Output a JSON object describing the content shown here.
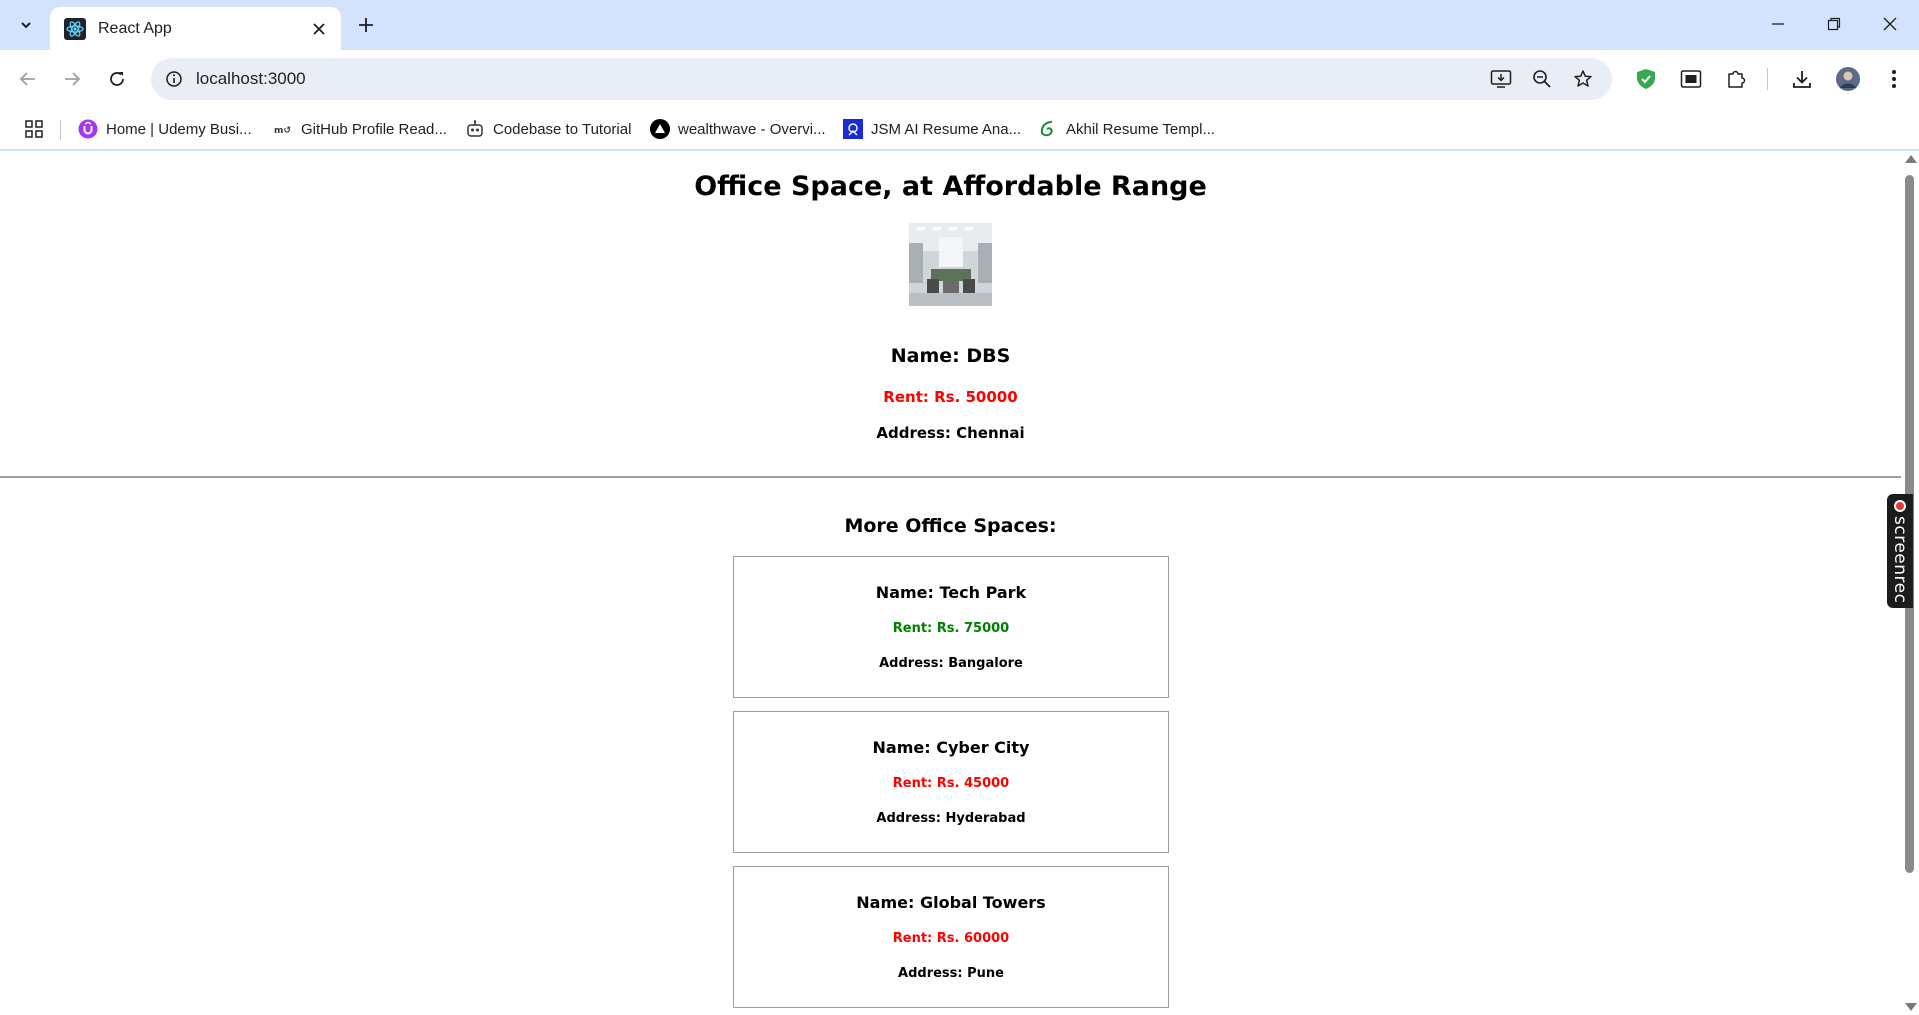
{
  "browser": {
    "tab_title": "React App",
    "url": "localhost:3000",
    "bookmarks": [
      {
        "label": "Home | Udemy Busi...",
        "icon": "udemy-icon"
      },
      {
        "label": "GitHub Profile Read...",
        "icon": "github-readme-icon"
      },
      {
        "label": "Codebase to Tutorial",
        "icon": "robot-icon"
      },
      {
        "label": "wealthwave - Overvi...",
        "icon": "vercel-icon"
      },
      {
        "label": "JSM AI Resume Ana...",
        "icon": "jsm-icon"
      },
      {
        "label": "Akhil Resume Templ...",
        "icon": "overleaf-icon"
      }
    ],
    "colors": {
      "chrome_bg": "#d3e3fd",
      "omnibox_bg": "#e9eef6"
    }
  },
  "page": {
    "title": "Office Space, at Affordable Range",
    "featured": {
      "name": "Name: DBS",
      "rent": "Rent: Rs. 50000",
      "rent_color": "#ff0000",
      "address": "Address: Chennai"
    },
    "more_heading": "More Office Spaces:",
    "offices": [
      {
        "name": "Name: Tech Park",
        "rent": "Rent: Rs. 75000",
        "rent_color": "#008000",
        "address": "Address: Bangalore"
      },
      {
        "name": "Name: Cyber City",
        "rent": "Rent: Rs. 45000",
        "rent_color": "#ff0000",
        "address": "Address: Hyderabad"
      },
      {
        "name": "Name: Global Towers",
        "rent": "Rent: Rs. 60000",
        "rent_color": "#ff0000",
        "address": "Address: Pune"
      }
    ]
  },
  "widget": {
    "label": "screenrec"
  }
}
